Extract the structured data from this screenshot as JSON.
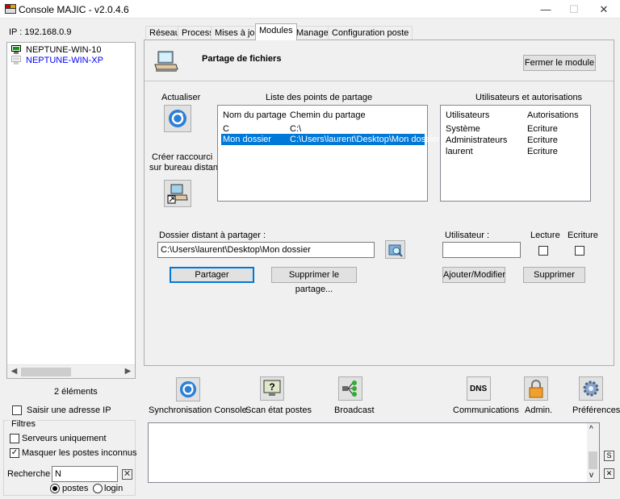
{
  "window": {
    "title": "Console MAJIC - v2.0.4.6",
    "minimize": "—",
    "maximize": "☐",
    "close": "✕"
  },
  "left": {
    "ip_label": "IP : 192.168.0.9",
    "hosts": [
      {
        "name": "NEPTUNE-WIN-10",
        "color": "#000000"
      },
      {
        "name": "NEPTUNE-WIN-XP",
        "color": "#0000ff"
      }
    ],
    "count": "2 éléments",
    "manual_ip": {
      "label": "Saisir une adresse IP",
      "checked": false
    },
    "filters": {
      "title": "Filtres",
      "servers_only": {
        "label": "Serveurs uniquement",
        "checked": false
      },
      "hide_unknown": {
        "label": "Masquer les postes inconnus",
        "checked": true
      },
      "search_label": "Recherche :",
      "search_value": "N",
      "clear": "✕",
      "radio_postes": "postes",
      "radio_login": "login",
      "selected": "postes"
    }
  },
  "tabs": [
    "Réseau",
    "Process",
    "Mises à jour",
    "Modules",
    "Manager",
    "Configuration poste"
  ],
  "active_tab": "Modules",
  "module": {
    "title": "Partage de fichiers",
    "close_button": "Fermer le module",
    "refresh_label": "Actualiser",
    "shortcut_label_1": "Créer raccourci",
    "shortcut_label_2": "sur bureau distant",
    "shares": {
      "title": "Liste des points de partage",
      "col_name": "Nom du partage",
      "col_path": "Chemin du partage",
      "rows": [
        {
          "name": "C",
          "path": "C:\\",
          "selected": false
        },
        {
          "name": "Mon dossier",
          "path": "C:\\Users\\laurent\\Desktop\\Mon dossier",
          "selected": true
        }
      ]
    },
    "users": {
      "title": "Utilisateurs et autorisations",
      "col_user": "Utilisateurs",
      "col_perm": "Autorisations",
      "rows": [
        {
          "user": "Système",
          "perm": "Ecriture"
        },
        {
          "user": "Administrateurs",
          "perm": "Ecriture"
        },
        {
          "user": "laurent",
          "perm": "Ecriture"
        }
      ]
    },
    "folder_label": "Dossier distant à partager :",
    "folder_value": "C:\\Users\\laurent\\Desktop\\Mon dossier",
    "share_button": "Partager",
    "delete_share_button": "Supprimer le partage...",
    "user_label": "Utilisateur :",
    "user_value": "",
    "read_label": "Lecture",
    "write_label": "Ecriture",
    "add_modify_button": "Ajouter/Modifier",
    "delete_button": "Supprimer"
  },
  "toolbar": {
    "sync": "Synchronisation Console",
    "scan": "Scan état postes",
    "broadcast": "Broadcast",
    "communications": "Communications",
    "dns": "DNS",
    "admin": "Admin.",
    "prefs": "Préférences"
  },
  "log": {
    "s_button": "S",
    "x_button": "✕",
    "up": "^",
    "down": "v"
  }
}
